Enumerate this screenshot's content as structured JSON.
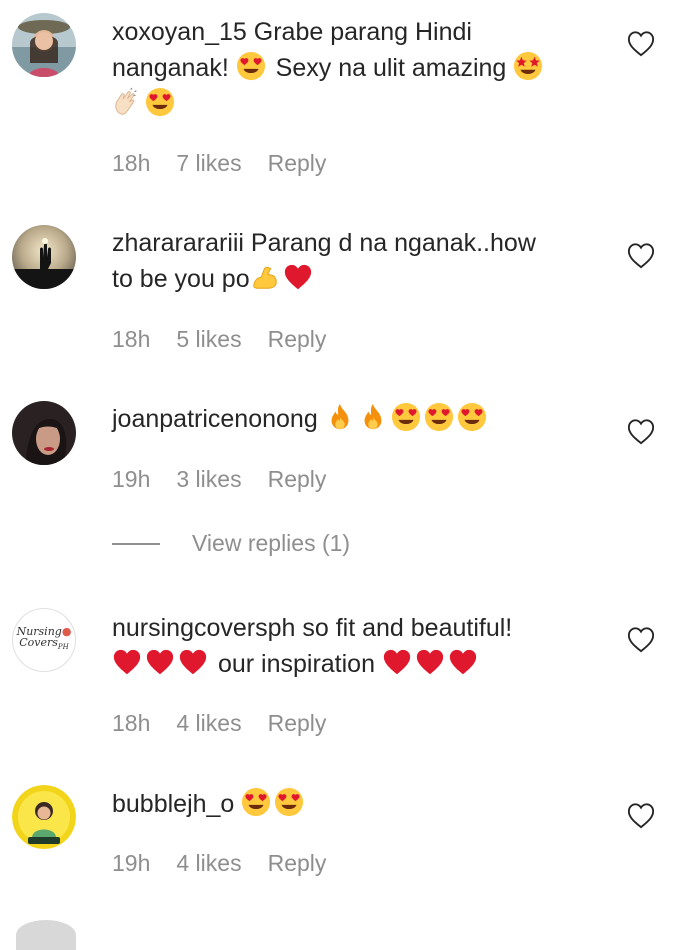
{
  "comments": [
    {
      "username": "xoxoyan_15",
      "line1": " Grabe parang Hindi",
      "line2a": "nanganak! ",
      "line2b": " Sexy na ulit amazing ",
      "time": "18h",
      "likes": "7 likes",
      "reply": "Reply"
    },
    {
      "username": "zharararariii",
      "line1": " Parang d na nganak..how",
      "line2": "to be you po",
      "time": "18h",
      "likes": "5 likes",
      "reply": "Reply"
    },
    {
      "username": "joanpatricenonong",
      "time": "19h",
      "likes": "3 likes",
      "reply": "Reply",
      "view_replies": "View replies (1)"
    },
    {
      "username": "nursingcoversph",
      "line1": " so fit and beautiful!",
      "line2": " our inspiration ",
      "time": "18h",
      "likes": "4 likes",
      "reply": "Reply",
      "avatar_logo_line1": "Nursing",
      "avatar_logo_line2": "Covers",
      "avatar_logo_line3": "PH"
    },
    {
      "username": "bubblejh_o",
      "time": "19h",
      "likes": "4 likes",
      "reply": "Reply"
    }
  ],
  "icons": {
    "like": "heart-outline-icon",
    "heart_eyes": "heart-eyes-emoji",
    "star_struck": "star-struck-emoji",
    "clap": "clapping-hands-emoji",
    "flex": "flexed-biceps-emoji",
    "red_heart": "red-heart-emoji",
    "fire": "fire-emoji"
  },
  "colors": {
    "text": "#262626",
    "meta": "#8e8e8e",
    "heart_red": "#e0182d",
    "emoji_yellow": "#ffc83d"
  }
}
